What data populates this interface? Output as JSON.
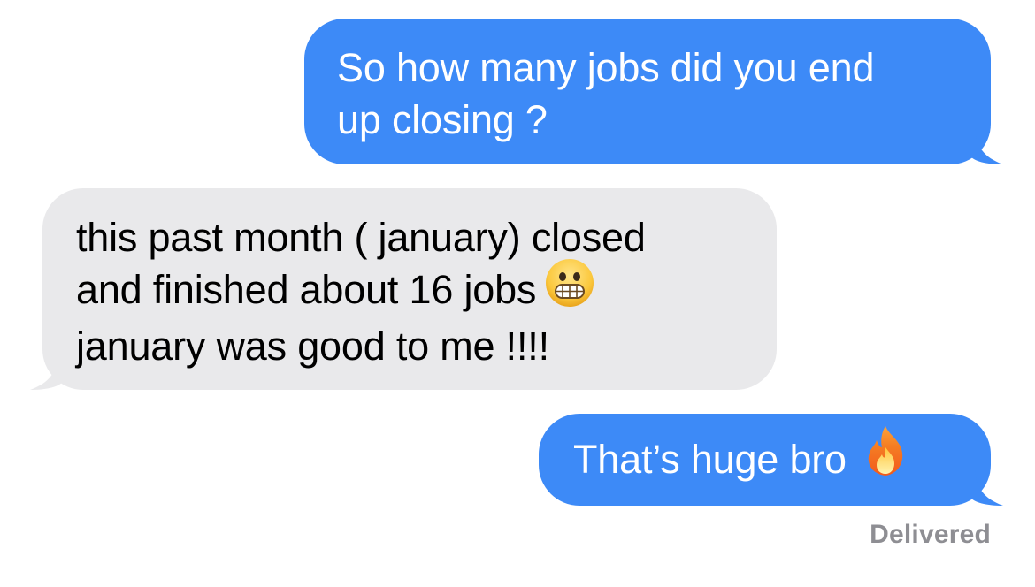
{
  "conversation": {
    "messages": [
      {
        "direction": "sent",
        "text": "So how many jobs did you end\nup closing ?",
        "emoji": ""
      },
      {
        "direction": "received",
        "text_before_emoji": "this past month ( january) closed\nand finished about 16 jobs",
        "emoji": "grimacing-face",
        "text_after_emoji": "january was good to me !!!!"
      },
      {
        "direction": "sent",
        "text": "That’s huge bro",
        "emoji": "fire"
      }
    ],
    "status": "Delivered"
  },
  "colors": {
    "sent_bubble": "#3d8af7",
    "received_bubble": "#e9e9eb",
    "status_text": "#8e8e93"
  }
}
